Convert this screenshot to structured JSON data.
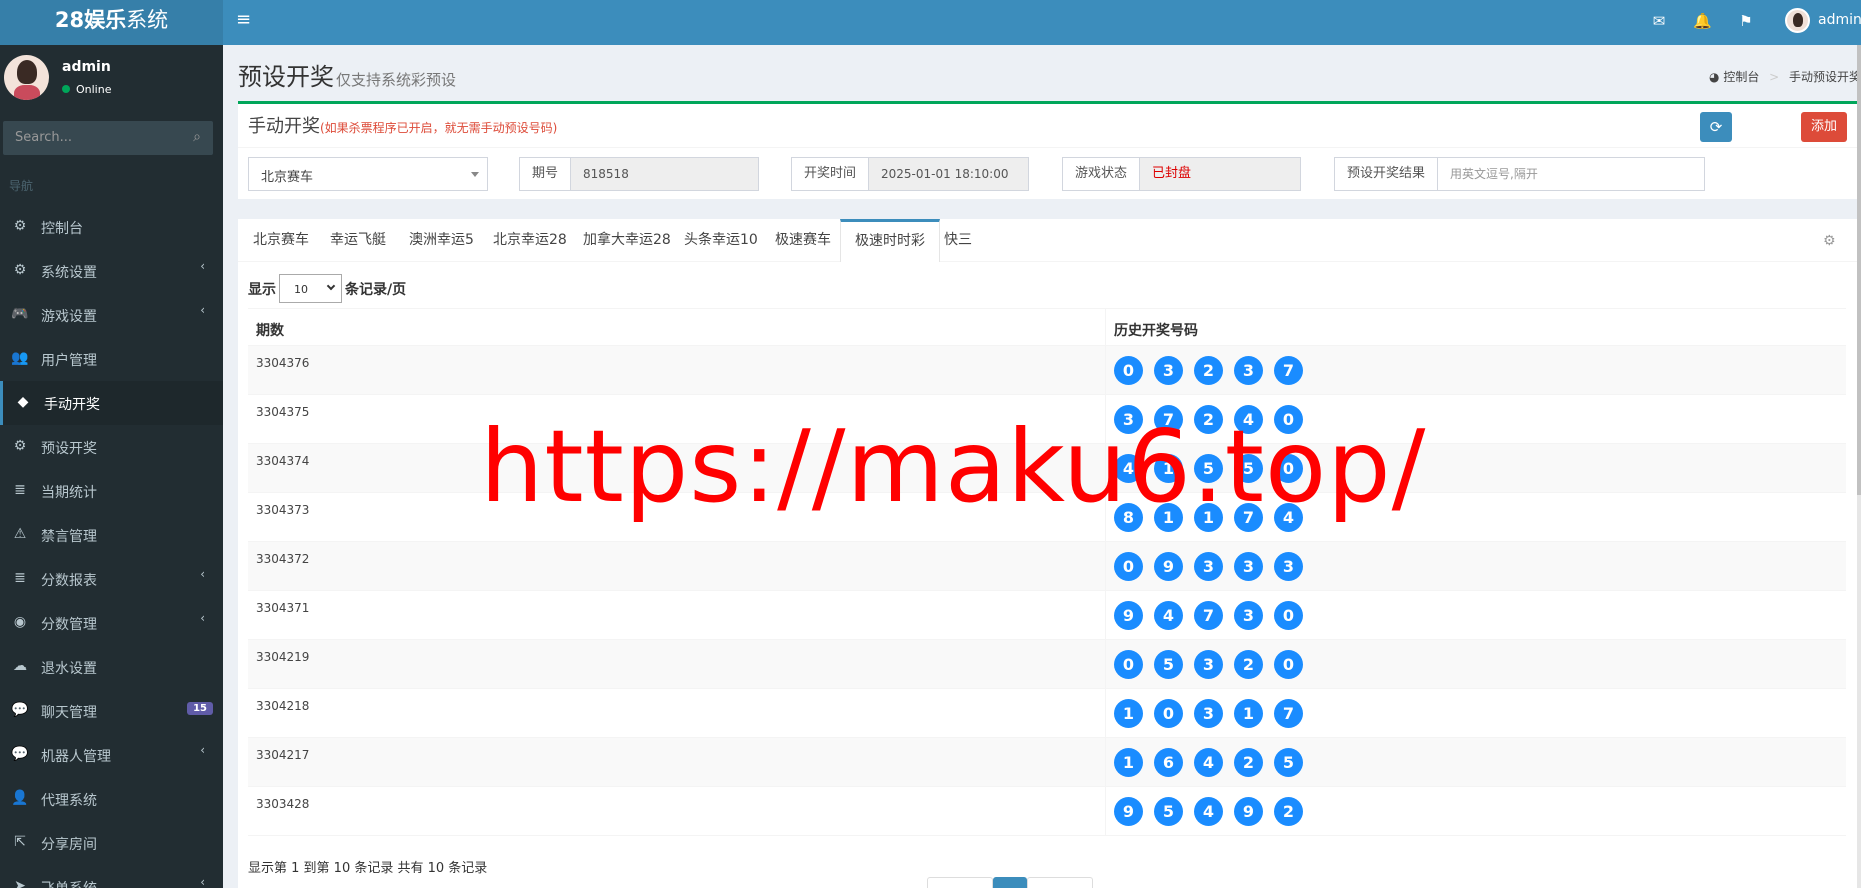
{
  "logo": {
    "bold": "28娱乐",
    "rest": "系统"
  },
  "header": {
    "user": "admin"
  },
  "sidebar": {
    "user_name": "admin",
    "status": "Online",
    "search_placeholder": "Search...",
    "nav_header": "导航",
    "items": [
      {
        "label": "控制台",
        "icon": "⚙",
        "chevron": false
      },
      {
        "label": "系统设置",
        "icon": "⚙",
        "chevron": true
      },
      {
        "label": "游戏设置",
        "icon": "🎮",
        "chevron": true
      },
      {
        "label": "用户管理",
        "icon": "👥",
        "chevron": false
      },
      {
        "label": "手动开奖",
        "icon": "◆",
        "chevron": false
      },
      {
        "label": "预设开奖",
        "icon": "⚙",
        "chevron": false
      },
      {
        "label": "当期统计",
        "icon": "≣",
        "chevron": false
      },
      {
        "label": "禁言管理",
        "icon": "⚠",
        "chevron": false
      },
      {
        "label": "分数报表",
        "icon": "≣",
        "chevron": true
      },
      {
        "label": "分数管理",
        "icon": "◉",
        "chevron": true
      },
      {
        "label": "退水设置",
        "icon": "☁",
        "chevron": false
      },
      {
        "label": "聊天管理",
        "icon": "💬",
        "chevron": false,
        "badge": "15"
      },
      {
        "label": "机器人管理",
        "icon": "💬",
        "chevron": true
      },
      {
        "label": "代理系统",
        "icon": "👤",
        "chevron": false
      },
      {
        "label": "分享房间",
        "icon": "⇱",
        "chevron": false
      },
      {
        "label": "飞单系统",
        "icon": "➤",
        "chevron": true
      }
    ]
  },
  "page": {
    "title": "预设开奖",
    "subtitle": "仅支持系统彩预设",
    "breadcrumb_home": "控制台",
    "breadcrumb_current": "手动预设开奖"
  },
  "form": {
    "title": "手动开奖",
    "warning": "(如果杀票程序已开启，就无需手动预设号码)",
    "add_label": "添加",
    "game_select": "北京赛车",
    "period_label": "期号",
    "period_value": "818518",
    "time_label": "开奖时间",
    "time_value": "2025-01-01 18:10:00",
    "state_label": "游戏状态",
    "state_value": "已封盘",
    "result_label": "预设开奖结果",
    "result_placeholder": "用英文逗号,隔开"
  },
  "tabs": [
    "北京赛车",
    "幸运飞艇",
    "澳洲幸运5",
    "北京幸运28",
    "加拿大幸运28",
    "头条幸运10",
    "极速赛车",
    "极速时时彩",
    "快三"
  ],
  "active_tab": 7,
  "length": {
    "prefix": "显示",
    "value": "10",
    "suffix": "条记录/页"
  },
  "table": {
    "col_period": "期数",
    "col_numbers": "历史开奖号码",
    "rows": [
      {
        "period": "3304376",
        "n": [
          "0",
          "3",
          "2",
          "3",
          "7"
        ]
      },
      {
        "period": "3304375",
        "n": [
          "3",
          "7",
          "2",
          "4",
          "0"
        ]
      },
      {
        "period": "3304374",
        "n": [
          "4",
          "1",
          "5",
          "5",
          "0"
        ]
      },
      {
        "period": "3304373",
        "n": [
          "8",
          "1",
          "1",
          "7",
          "4"
        ]
      },
      {
        "period": "3304372",
        "n": [
          "0",
          "9",
          "3",
          "3",
          "3"
        ]
      },
      {
        "period": "3304371",
        "n": [
          "9",
          "4",
          "7",
          "3",
          "0"
        ]
      },
      {
        "period": "3304219",
        "n": [
          "0",
          "5",
          "3",
          "2",
          "0"
        ]
      },
      {
        "period": "3304218",
        "n": [
          "1",
          "0",
          "3",
          "1",
          "7"
        ]
      },
      {
        "period": "3304217",
        "n": [
          "1",
          "6",
          "4",
          "2",
          "5"
        ]
      },
      {
        "period": "3303428",
        "n": [
          "9",
          "5",
          "4",
          "9",
          "2"
        ]
      }
    ]
  },
  "info": "显示第 1 到第 10 条记录 共有 10 条记录",
  "watermark": "https://maku6.top/"
}
